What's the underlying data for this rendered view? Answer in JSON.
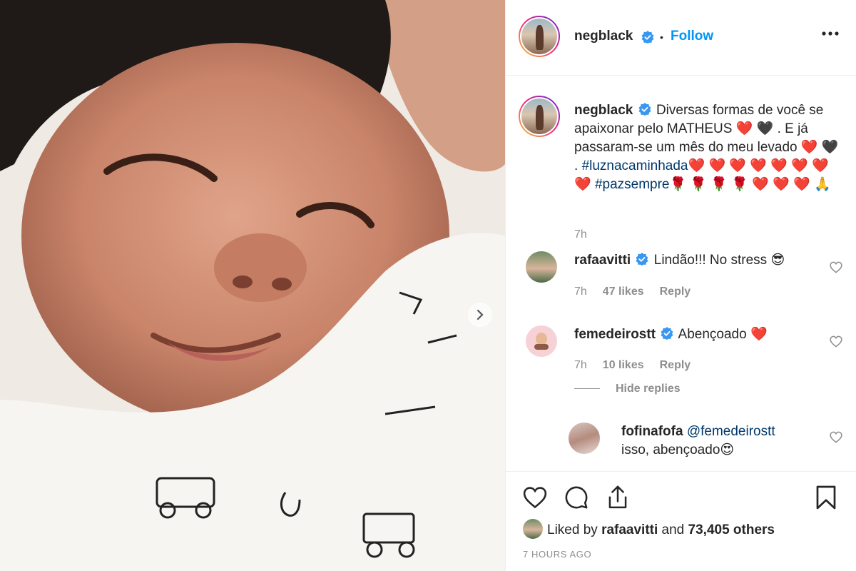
{
  "post": {
    "author": "negblack",
    "follow_label": "Follow",
    "dot": "•",
    "more_icon": "more-horizontal-icon",
    "caption": {
      "text_before": "Diversas formas de você se apaixonar pelo MATHEUS ❤️ 🖤 . E já passaram-se um mês do meu levado ❤️ 🖤 . ",
      "hashtag1": "#luznacaminhada",
      "text_middle": "❤️ ❤️ ❤️ ❤️ ❤️ ❤️ ❤️ ❤️  ",
      "hashtag2": "#pazsempre",
      "text_after": "🌹 🌹 🌹 🌹 ❤️ ❤️ ❤️ 🙏",
      "time": "7h"
    },
    "comments": [
      {
        "user": "rafaavitti",
        "text": "Lindão!!! No stress 😎",
        "time": "7h",
        "likes": "47 likes",
        "reply": "Reply"
      },
      {
        "user": "femedeirostt",
        "text": "Abençoado ❤️",
        "time": "7h",
        "likes": "10 likes",
        "reply": "Reply"
      }
    ],
    "hide_replies": "Hide replies",
    "reply": {
      "user": "fofinafofa",
      "mention": "@femedeirostt",
      "text": "isso, abençoado😍"
    },
    "liked_by": {
      "prefix": "Liked by",
      "user": "rafaavitti",
      "mid": "and",
      "count": "73,405 others"
    },
    "posted_ago": "7 HOURS AGO"
  },
  "colors": {
    "accent": "#0095f6",
    "text": "#262626",
    "muted": "#8e8e8e",
    "hashtag": "#00376b",
    "verified": "#3897f0"
  }
}
